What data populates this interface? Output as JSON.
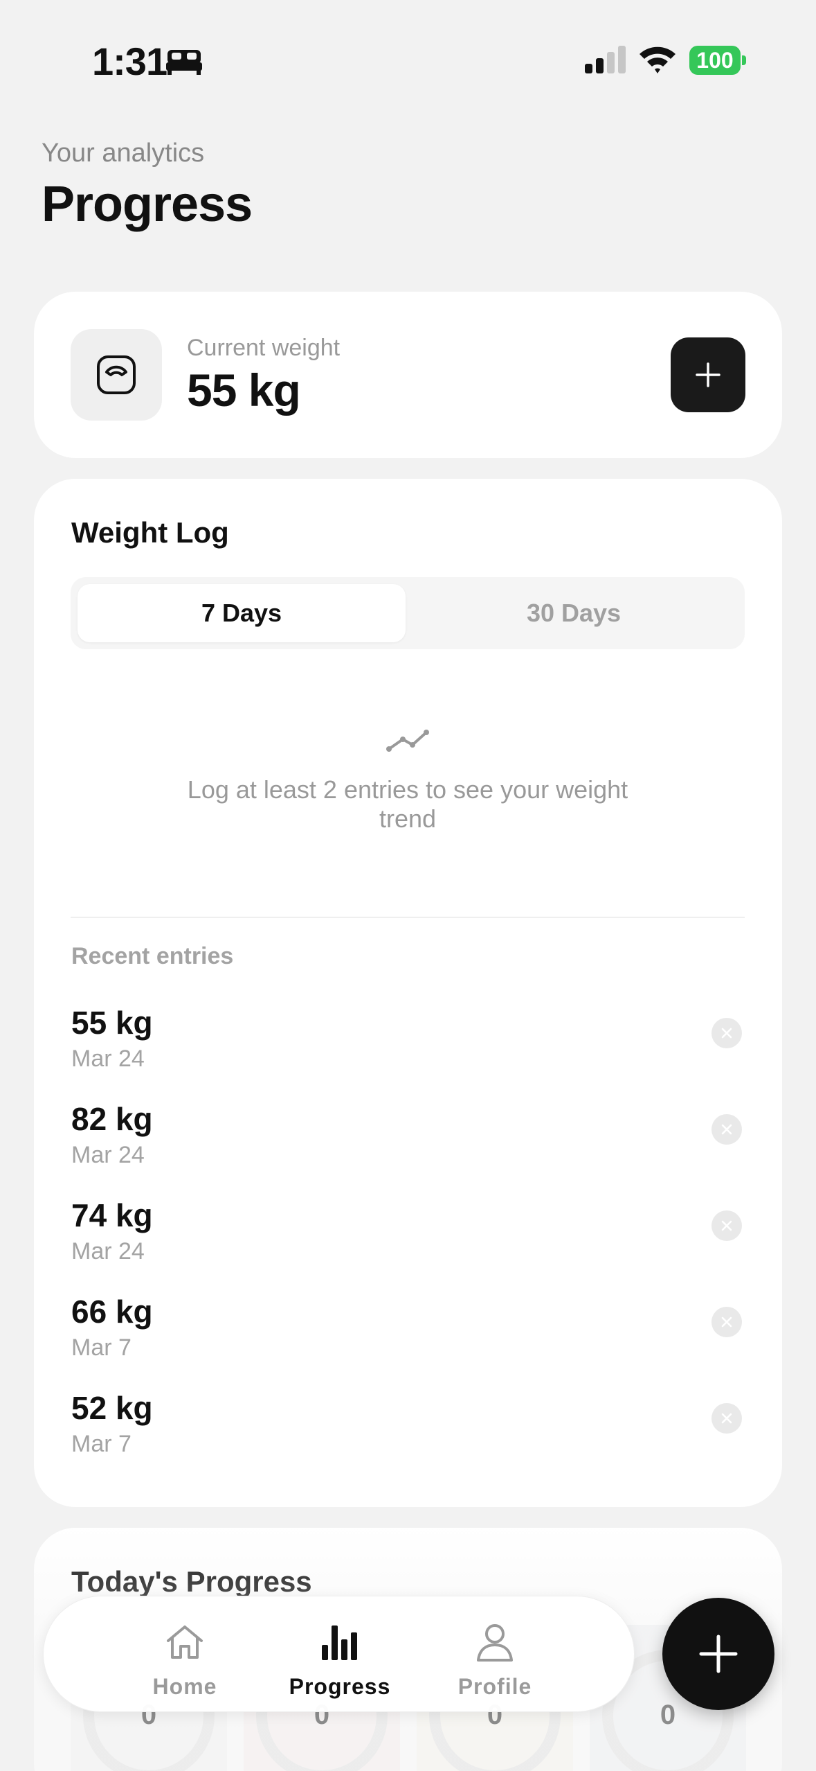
{
  "status_bar": {
    "time": "1:31",
    "battery": "100"
  },
  "header": {
    "subtitle": "Your analytics",
    "title": "Progress"
  },
  "current_weight": {
    "label": "Current weight",
    "value": "55 kg"
  },
  "weight_log": {
    "title": "Weight Log",
    "tabs": [
      {
        "label": "7 Days",
        "selected": true
      },
      {
        "label": "30 Days",
        "selected": false
      }
    ],
    "empty_message": "Log at least 2 entries to see your weight trend",
    "recent_label": "Recent entries",
    "entries": [
      {
        "weight": "55 kg",
        "date": "Mar 24"
      },
      {
        "weight": "82 kg",
        "date": "Mar 24"
      },
      {
        "weight": "74 kg",
        "date": "Mar 24"
      },
      {
        "weight": "66 kg",
        "date": "Mar 7"
      },
      {
        "weight": "52 kg",
        "date": "Mar 7"
      }
    ]
  },
  "todays_progress": {
    "title": "Today's Progress",
    "values": [
      "0",
      "0",
      "0",
      "0"
    ]
  },
  "bottom_nav": {
    "items": [
      {
        "label": "Home",
        "icon": "home-icon",
        "active": false
      },
      {
        "label": "Progress",
        "icon": "bar-chart-icon",
        "active": true
      },
      {
        "label": "Profile",
        "icon": "person-icon",
        "active": false
      }
    ]
  },
  "colors": {
    "battery": "#35c759",
    "primary": "#111111",
    "muted": "#9a9a9a",
    "background": "#f2f2f2"
  }
}
